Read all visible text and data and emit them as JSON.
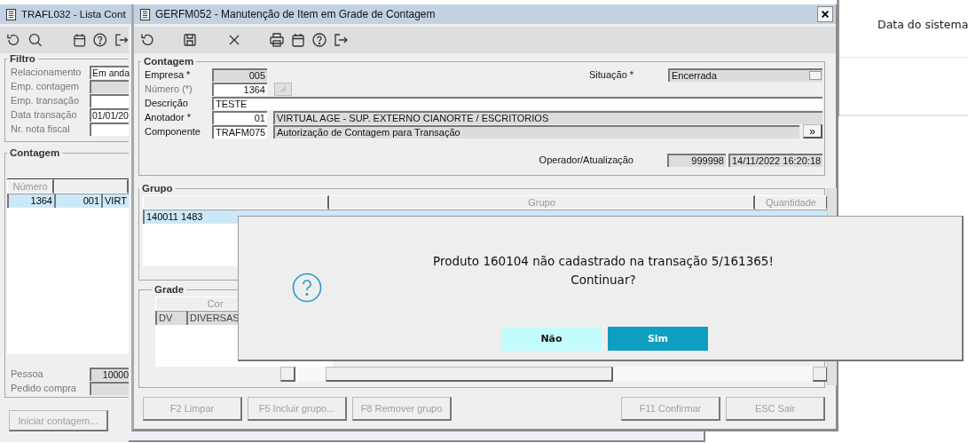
{
  "background_panel": {
    "label": "Data do sistema"
  },
  "list_window": {
    "title": "TRAFL032 - Lista Cont",
    "filter": {
      "title": "Filtro",
      "fields": [
        {
          "label": "Relacionamento",
          "value": "Em anda",
          "kind": "text"
        },
        {
          "label": "Emp. contagem",
          "kind": "readonly"
        },
        {
          "label": "Emp. transação",
          "kind": "text"
        },
        {
          "label": "Data transação",
          "value": "01/01/20",
          "kind": "text"
        },
        {
          "label": "Nr. nota fiscal",
          "kind": "text"
        }
      ]
    },
    "counts": {
      "title": "Contagem",
      "columns": [
        {
          "label": "Número"
        }
      ],
      "rows": [
        {
          "cells": [
            "1364",
            "001",
            "VIRT"
          ],
          "selected": true
        }
      ]
    },
    "footer_fields": [
      {
        "label": "Pessoa",
        "value": "10000"
      },
      {
        "label": "Pedido compra"
      }
    ],
    "button": {
      "label": "Iniciar contagem...",
      "disabled": true
    }
  },
  "edit_window": {
    "title": "GERFM052 - Manutenção de Item em Grade de Contagem",
    "counting": {
      "title": "Contagem",
      "company": {
        "label": "Empresa *",
        "value": "005"
      },
      "number": {
        "label": "Número (*)",
        "value": "1364",
        "disabled": true
      },
      "description": {
        "label": "Descrição",
        "value": "TESTE"
      },
      "annotator": {
        "label": "Anotador *",
        "code": "01",
        "name": "VIRTUAL AGE - SUP. EXTERNO CIANORTE / ESCRITORIOS"
      },
      "component": {
        "label": "Componente",
        "code": "TRAFM075",
        "name": "Autorização de Contagem para Transação",
        "button": "»"
      },
      "status": {
        "label": "Situação *",
        "value": "Encerrada"
      },
      "operator": {
        "label": "Operador/Atualização",
        "code": "999998",
        "updated": "14/11/2022 16:20:18"
      }
    },
    "group": {
      "title": "Grupo",
      "columns": [
        {
          "label": "Grupo"
        },
        {
          "label": "Quantidade"
        }
      ],
      "rows": [
        {
          "cells": [
            "140011 1483"
          ],
          "selected": true
        }
      ]
    },
    "grid": {
      "title": "Grade",
      "band_label": "Cor",
      "rows": [
        {
          "cells": [
            "DV",
            "DIVERSAS"
          ],
          "selected": false
        }
      ]
    },
    "buttons": [
      {
        "label": "F2 Limpar",
        "disabled": true
      },
      {
        "label": "F5 Incluir grupo...",
        "disabled": true
      },
      {
        "label": "F8 Remover grupo",
        "disabled": true
      },
      {
        "label": "F11 Confirmar",
        "disabled": true
      },
      {
        "label": "ESC Sair",
        "disabled": true
      }
    ]
  },
  "dialog": {
    "message": [
      "Produto 160104 não cadastrado na transação 5/161365!",
      "Continuar?"
    ],
    "buttons": [
      {
        "label": "Não",
        "selected": false
      },
      {
        "label": "Sim",
        "selected": true
      }
    ]
  }
}
